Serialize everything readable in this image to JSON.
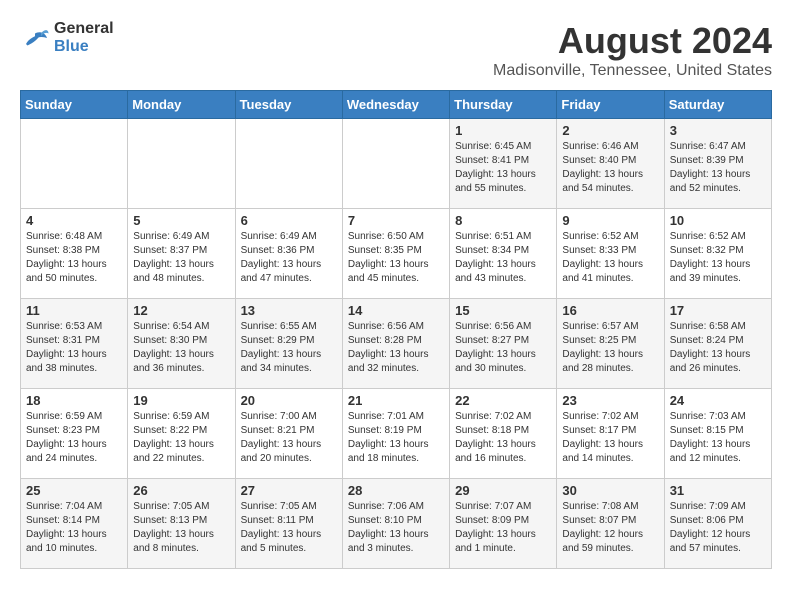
{
  "header": {
    "logo_line1": "General",
    "logo_line2": "Blue",
    "main_title": "August 2024",
    "subtitle": "Madisonville, Tennessee, United States"
  },
  "calendar": {
    "days_of_week": [
      "Sunday",
      "Monday",
      "Tuesday",
      "Wednesday",
      "Thursday",
      "Friday",
      "Saturday"
    ],
    "weeks": [
      [
        {
          "day": "",
          "sunrise": "",
          "sunset": "",
          "daylight": ""
        },
        {
          "day": "",
          "sunrise": "",
          "sunset": "",
          "daylight": ""
        },
        {
          "day": "",
          "sunrise": "",
          "sunset": "",
          "daylight": ""
        },
        {
          "day": "",
          "sunrise": "",
          "sunset": "",
          "daylight": ""
        },
        {
          "day": "1",
          "sunrise": "Sunrise: 6:45 AM",
          "sunset": "Sunset: 8:41 PM",
          "daylight": "Daylight: 13 hours and 55 minutes."
        },
        {
          "day": "2",
          "sunrise": "Sunrise: 6:46 AM",
          "sunset": "Sunset: 8:40 PM",
          "daylight": "Daylight: 13 hours and 54 minutes."
        },
        {
          "day": "3",
          "sunrise": "Sunrise: 6:47 AM",
          "sunset": "Sunset: 8:39 PM",
          "daylight": "Daylight: 13 hours and 52 minutes."
        }
      ],
      [
        {
          "day": "4",
          "sunrise": "Sunrise: 6:48 AM",
          "sunset": "Sunset: 8:38 PM",
          "daylight": "Daylight: 13 hours and 50 minutes."
        },
        {
          "day": "5",
          "sunrise": "Sunrise: 6:49 AM",
          "sunset": "Sunset: 8:37 PM",
          "daylight": "Daylight: 13 hours and 48 minutes."
        },
        {
          "day": "6",
          "sunrise": "Sunrise: 6:49 AM",
          "sunset": "Sunset: 8:36 PM",
          "daylight": "Daylight: 13 hours and 47 minutes."
        },
        {
          "day": "7",
          "sunrise": "Sunrise: 6:50 AM",
          "sunset": "Sunset: 8:35 PM",
          "daylight": "Daylight: 13 hours and 45 minutes."
        },
        {
          "day": "8",
          "sunrise": "Sunrise: 6:51 AM",
          "sunset": "Sunset: 8:34 PM",
          "daylight": "Daylight: 13 hours and 43 minutes."
        },
        {
          "day": "9",
          "sunrise": "Sunrise: 6:52 AM",
          "sunset": "Sunset: 8:33 PM",
          "daylight": "Daylight: 13 hours and 41 minutes."
        },
        {
          "day": "10",
          "sunrise": "Sunrise: 6:52 AM",
          "sunset": "Sunset: 8:32 PM",
          "daylight": "Daylight: 13 hours and 39 minutes."
        }
      ],
      [
        {
          "day": "11",
          "sunrise": "Sunrise: 6:53 AM",
          "sunset": "Sunset: 8:31 PM",
          "daylight": "Daylight: 13 hours and 38 minutes."
        },
        {
          "day": "12",
          "sunrise": "Sunrise: 6:54 AM",
          "sunset": "Sunset: 8:30 PM",
          "daylight": "Daylight: 13 hours and 36 minutes."
        },
        {
          "day": "13",
          "sunrise": "Sunrise: 6:55 AM",
          "sunset": "Sunset: 8:29 PM",
          "daylight": "Daylight: 13 hours and 34 minutes."
        },
        {
          "day": "14",
          "sunrise": "Sunrise: 6:56 AM",
          "sunset": "Sunset: 8:28 PM",
          "daylight": "Daylight: 13 hours and 32 minutes."
        },
        {
          "day": "15",
          "sunrise": "Sunrise: 6:56 AM",
          "sunset": "Sunset: 8:27 PM",
          "daylight": "Daylight: 13 hours and 30 minutes."
        },
        {
          "day": "16",
          "sunrise": "Sunrise: 6:57 AM",
          "sunset": "Sunset: 8:25 PM",
          "daylight": "Daylight: 13 hours and 28 minutes."
        },
        {
          "day": "17",
          "sunrise": "Sunrise: 6:58 AM",
          "sunset": "Sunset: 8:24 PM",
          "daylight": "Daylight: 13 hours and 26 minutes."
        }
      ],
      [
        {
          "day": "18",
          "sunrise": "Sunrise: 6:59 AM",
          "sunset": "Sunset: 8:23 PM",
          "daylight": "Daylight: 13 hours and 24 minutes."
        },
        {
          "day": "19",
          "sunrise": "Sunrise: 6:59 AM",
          "sunset": "Sunset: 8:22 PM",
          "daylight": "Daylight: 13 hours and 22 minutes."
        },
        {
          "day": "20",
          "sunrise": "Sunrise: 7:00 AM",
          "sunset": "Sunset: 8:21 PM",
          "daylight": "Daylight: 13 hours and 20 minutes."
        },
        {
          "day": "21",
          "sunrise": "Sunrise: 7:01 AM",
          "sunset": "Sunset: 8:19 PM",
          "daylight": "Daylight: 13 hours and 18 minutes."
        },
        {
          "day": "22",
          "sunrise": "Sunrise: 7:02 AM",
          "sunset": "Sunset: 8:18 PM",
          "daylight": "Daylight: 13 hours and 16 minutes."
        },
        {
          "day": "23",
          "sunrise": "Sunrise: 7:02 AM",
          "sunset": "Sunset: 8:17 PM",
          "daylight": "Daylight: 13 hours and 14 minutes."
        },
        {
          "day": "24",
          "sunrise": "Sunrise: 7:03 AM",
          "sunset": "Sunset: 8:15 PM",
          "daylight": "Daylight: 13 hours and 12 minutes."
        }
      ],
      [
        {
          "day": "25",
          "sunrise": "Sunrise: 7:04 AM",
          "sunset": "Sunset: 8:14 PM",
          "daylight": "Daylight: 13 hours and 10 minutes."
        },
        {
          "day": "26",
          "sunrise": "Sunrise: 7:05 AM",
          "sunset": "Sunset: 8:13 PM",
          "daylight": "Daylight: 13 hours and 8 minutes."
        },
        {
          "day": "27",
          "sunrise": "Sunrise: 7:05 AM",
          "sunset": "Sunset: 8:11 PM",
          "daylight": "Daylight: 13 hours and 5 minutes."
        },
        {
          "day": "28",
          "sunrise": "Sunrise: 7:06 AM",
          "sunset": "Sunset: 8:10 PM",
          "daylight": "Daylight: 13 hours and 3 minutes."
        },
        {
          "day": "29",
          "sunrise": "Sunrise: 7:07 AM",
          "sunset": "Sunset: 8:09 PM",
          "daylight": "Daylight: 13 hours and 1 minute."
        },
        {
          "day": "30",
          "sunrise": "Sunrise: 7:08 AM",
          "sunset": "Sunset: 8:07 PM",
          "daylight": "Daylight: 12 hours and 59 minutes."
        },
        {
          "day": "31",
          "sunrise": "Sunrise: 7:09 AM",
          "sunset": "Sunset: 8:06 PM",
          "daylight": "Daylight: 12 hours and 57 minutes."
        }
      ]
    ]
  }
}
